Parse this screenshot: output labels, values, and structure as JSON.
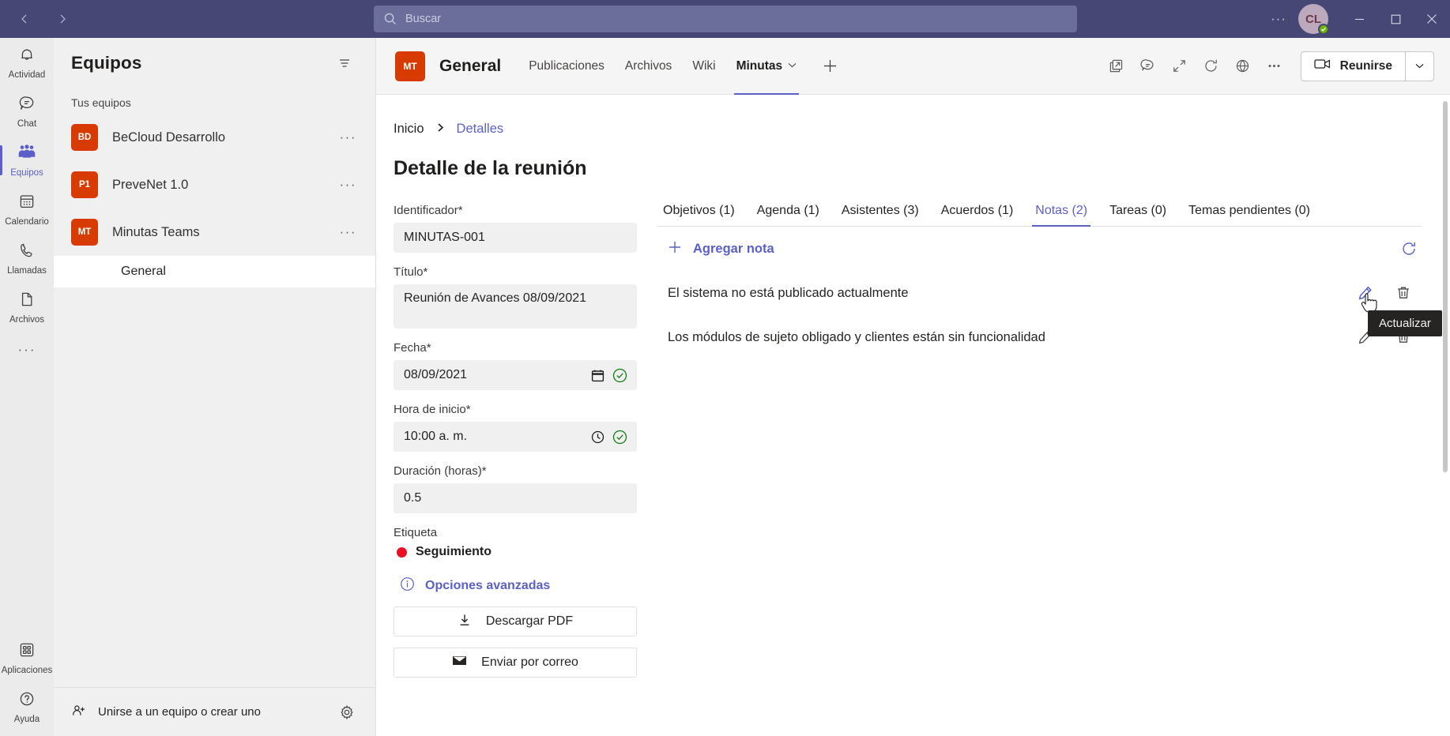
{
  "titlebar": {
    "back_icon": "chevron-left-icon",
    "forward_icon": "chevron-right-icon",
    "search_placeholder": "Buscar",
    "more_label": "···",
    "avatar_initials": "CL",
    "presence": "available",
    "minimize_label": "—",
    "maximize_label": "☐",
    "close_label": "✕"
  },
  "rail": {
    "items": [
      {
        "label": "Actividad",
        "icon": "bell-icon",
        "active": false
      },
      {
        "label": "Chat",
        "icon": "chat-icon",
        "active": false
      },
      {
        "label": "Equipos",
        "icon": "teams-icon",
        "active": true
      },
      {
        "label": "Calendario",
        "icon": "calendar-icon",
        "active": false
      },
      {
        "label": "Llamadas",
        "icon": "phone-icon",
        "active": false
      },
      {
        "label": "Archivos",
        "icon": "file-icon",
        "active": false
      }
    ],
    "more_label": "···",
    "bottom": [
      {
        "label": "Aplicaciones",
        "icon": "apps-icon"
      },
      {
        "label": "Ayuda",
        "icon": "help-icon"
      }
    ]
  },
  "teams_pane": {
    "title": "Equipos",
    "filter_icon": "filter-icon",
    "section_label": "Tus equipos",
    "teams": [
      {
        "initials": "BD",
        "name": "BeCloud Desarrollo",
        "color": "#d83b01",
        "more": "···"
      },
      {
        "initials": "P1",
        "name": "PreveNet 1.0",
        "color": "#d83b01",
        "more": "···"
      },
      {
        "initials": "MT",
        "name": "Minutas Teams",
        "color": "#d83b01",
        "more": "···"
      }
    ],
    "channel": "General",
    "footer_label": "Unirse a un equipo o crear uno",
    "footer_icon": "join-team-icon",
    "gear_icon": "gear-icon"
  },
  "channel_header": {
    "avatar_initials": "MT",
    "name": "General",
    "tabs": [
      {
        "label": "Publicaciones",
        "active": false
      },
      {
        "label": "Archivos",
        "active": false
      },
      {
        "label": "Wiki",
        "active": false
      },
      {
        "label": "Minutas",
        "active": true,
        "caret": "⌄"
      }
    ],
    "add_tab": "+",
    "icons": [
      "open-in-new-window-icon",
      "conversation-icon",
      "expand-icon",
      "refresh-icon",
      "globe-icon",
      "more-icon"
    ],
    "meet_label": "Reunirse",
    "meet_icon": "video-camera-icon",
    "meet_caret": "⌄"
  },
  "page": {
    "breadcrumb": {
      "home": "Inicio",
      "separator": "›",
      "current": "Detalles"
    },
    "title": "Detalle de la reunión",
    "form": {
      "fields": [
        {
          "label": "Identificador*",
          "value": "MINUTAS-001",
          "tall": false,
          "icon": null,
          "valid": false
        },
        {
          "label": "Título*",
          "value": "Reunión  de Avances 08/09/2021",
          "tall": true,
          "icon": null,
          "valid": false
        },
        {
          "label": "Fecha*",
          "value": "08/09/2021",
          "tall": false,
          "icon": "calendar-picker-icon",
          "valid": true
        },
        {
          "label": "Hora de inicio*",
          "value": "10:00  a. m.",
          "tall": false,
          "icon": "clock-icon",
          "valid": true
        },
        {
          "label": "Duración (horas)*",
          "value": "0.5",
          "tall": false,
          "icon": null,
          "valid": false
        }
      ],
      "tag_label": "Etiqueta",
      "tag_name": "Seguimiento",
      "tag_color": "#e81123",
      "advanced_label": "Opciones avanzadas",
      "advanced_icon": "info-icon",
      "buttons": [
        {
          "label": "Descargar PDF",
          "icon": "download-icon"
        },
        {
          "label": "Enviar por correo",
          "icon": "mail-icon"
        }
      ]
    },
    "panel": {
      "tabs": [
        {
          "label": "Objetivos (1)",
          "active": false
        },
        {
          "label": "Agenda (1)",
          "active": false
        },
        {
          "label": "Asistentes (3)",
          "active": false
        },
        {
          "label": "Acuerdos (1)",
          "active": false
        },
        {
          "label": "Notas (2)",
          "active": true
        },
        {
          "label": "Tareas (0)",
          "active": false
        },
        {
          "label": "Temas pendientes (0)",
          "active": false
        }
      ],
      "add_label": "Agregar nota",
      "add_icon": "plus-icon",
      "refresh_icon": "refresh-icon",
      "notes": [
        {
          "text": "El sistema no está publicado actualmente",
          "edit_icon": "pencil-icon",
          "delete_icon": "trash-icon",
          "hovered": true
        },
        {
          "text": "Los módulos de sujeto obligado y clientes están sin funcionalidad",
          "edit_icon": "pencil-icon",
          "delete_icon": "trash-icon",
          "hovered": false
        }
      ],
      "tooltip": "Actualizar"
    }
  },
  "colors": {
    "brand_purple": "#5b5fc7",
    "titlebar": "#464775",
    "team_avatar": "#d83b01",
    "valid_green": "#107c10"
  }
}
